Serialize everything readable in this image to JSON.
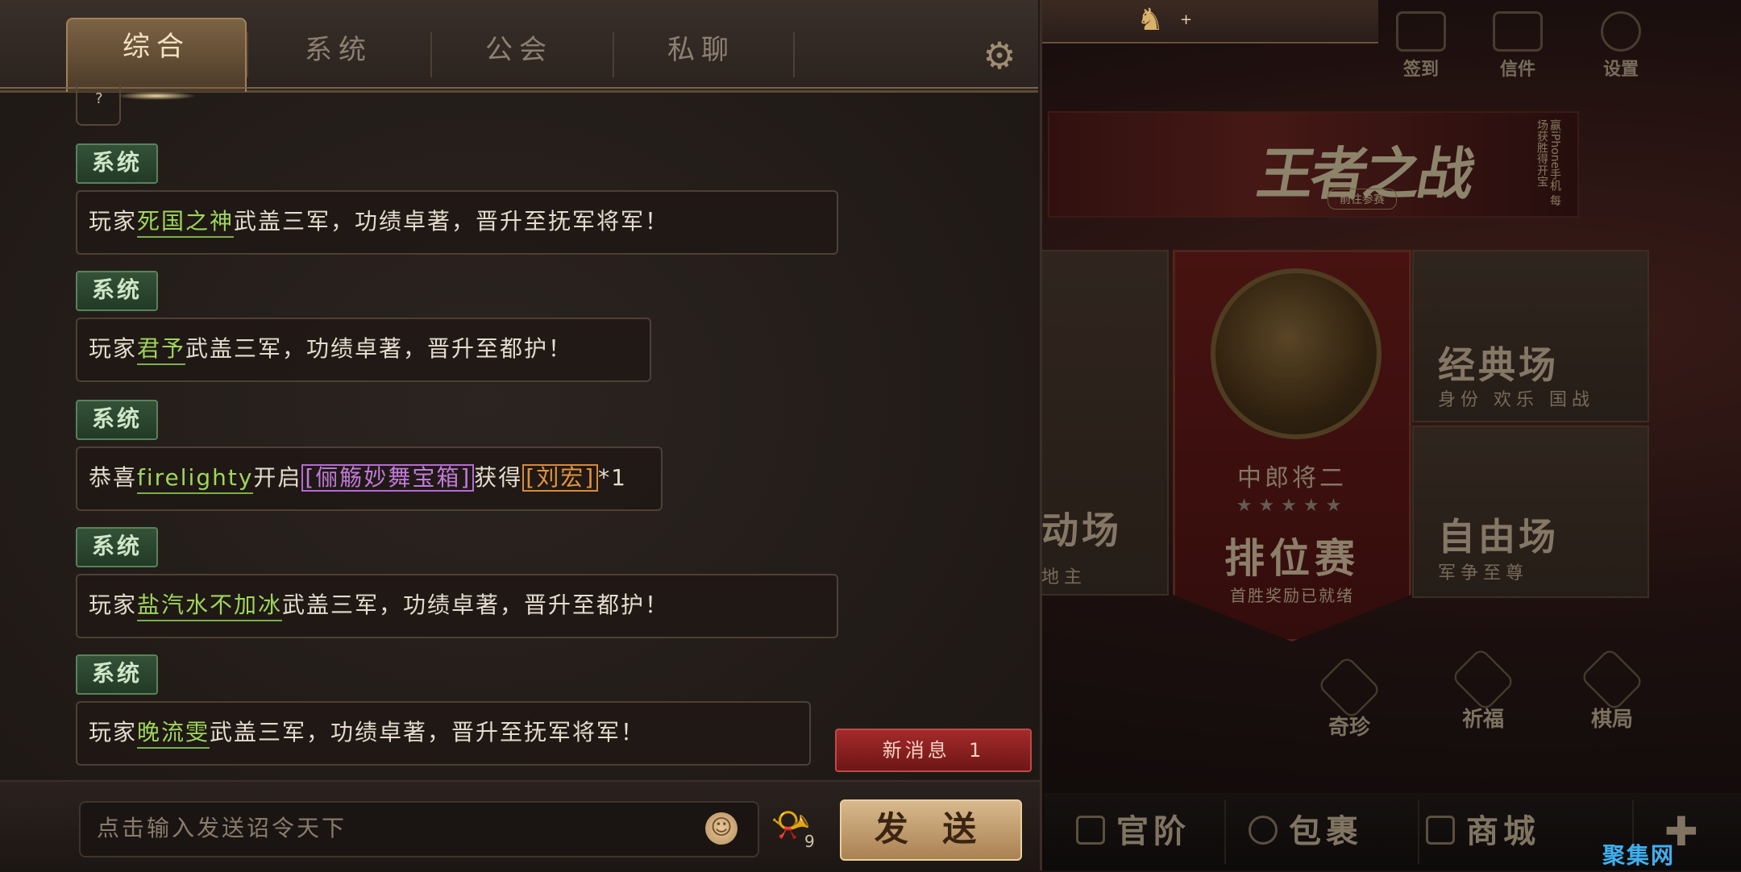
{
  "tabs": [
    {
      "label": "综合",
      "active": true
    },
    {
      "label": "系统",
      "active": false
    },
    {
      "label": "公会",
      "active": false
    },
    {
      "label": "私聊",
      "active": false
    }
  ],
  "horse_value": "+",
  "scroll_fragment_text": "?",
  "messages": [
    {
      "badge": "系统",
      "prefix": "玩家",
      "name": "死国之神",
      "suffix": "武盖三军，功绩卓著，晋升至抚军将军！"
    },
    {
      "badge": "系统",
      "prefix": "玩家",
      "name": "君予",
      "suffix": "武盖三军，功绩卓著，晋升至都护！"
    },
    {
      "badge": "系统",
      "prefix": "恭喜",
      "name": "firelighty",
      "mid": "开启",
      "item1": "[俪觞妙舞宝箱]",
      "mid2": "获得",
      "item2": "[刘宏]",
      "count": "*1"
    },
    {
      "badge": "系统",
      "prefix": "玩家",
      "name": "盐汽水不加冰",
      "suffix": "武盖三军，功绩卓著，晋升至都护！"
    },
    {
      "badge": "系统",
      "prefix": "玩家",
      "name": "晚流雯",
      "suffix": "武盖三军，功绩卓著，晋升至抚军将军！"
    }
  ],
  "new_message": {
    "label": "新消息",
    "count": "1"
  },
  "input": {
    "placeholder": "点击输入发送诏令天下"
  },
  "horn_count": "9",
  "send_label": "发 送",
  "top_icons": [
    {
      "label": "签到",
      "icon": "checkin-icon"
    },
    {
      "label": "信件",
      "icon": "mail-icon"
    },
    {
      "label": "设置",
      "icon": "settings-icon"
    }
  ],
  "banner": {
    "title": "王者之战",
    "sub": "前往参赛",
    "side": "赢iPhone手机 每场获胜得开宝"
  },
  "modes": {
    "classic": {
      "title": "经典场",
      "sub": "身份 欢乐 国战"
    },
    "free": {
      "title": "自由场",
      "sub": "军争至尊"
    },
    "left_partial_title": "动场",
    "left_partial_sub": "地主"
  },
  "ranked": {
    "rank": "中郎将二",
    "stars": "★★★★★",
    "title": "排位赛",
    "sub": "首胜奖励已就绪"
  },
  "round_buttons": [
    {
      "label": "奇珍",
      "icon": "treasure-icon"
    },
    {
      "label": "祈福",
      "icon": "blessing-icon"
    },
    {
      "label": "棋局",
      "icon": "chess-icon"
    }
  ],
  "bottom_menu": [
    {
      "label": "官阶",
      "icon": "rank-icon"
    },
    {
      "label": "包裹",
      "icon": "bag-icon"
    },
    {
      "label": "商城",
      "icon": "shop-icon"
    }
  ],
  "watermark": "聚集网",
  "colors": {
    "name_green": "#9fd65a",
    "item_purple": "#c17ad9",
    "item_orange": "#e3943b",
    "badge_green": "#345238",
    "new_msg_red": "#a42a2a",
    "send_gold": "#d8b98d"
  }
}
